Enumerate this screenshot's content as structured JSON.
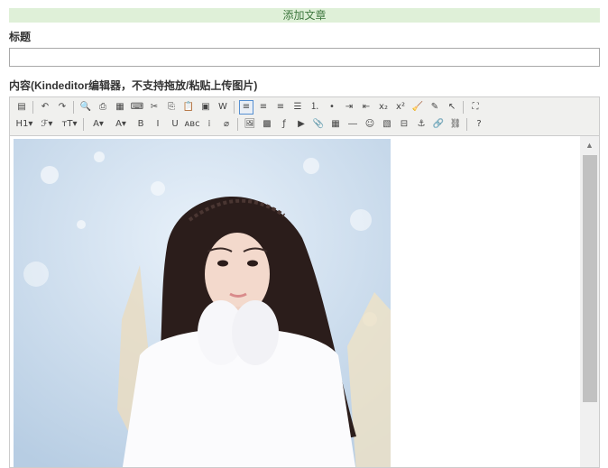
{
  "page": {
    "header": "添加文章"
  },
  "form": {
    "title_label": "标题",
    "title_value": "",
    "content_label": "内容(Kindeditor编辑器，不支持拖放/粘贴上传图片)"
  },
  "editor": {
    "toolbar_row1": [
      {
        "name": "source-icon",
        "glyph": "▤"
      },
      {
        "sep": true
      },
      {
        "name": "undo-icon",
        "glyph": "↶"
      },
      {
        "name": "redo-icon",
        "glyph": "↷"
      },
      {
        "sep": true
      },
      {
        "name": "preview-icon",
        "glyph": "🔍"
      },
      {
        "name": "print-icon",
        "glyph": "⎙"
      },
      {
        "name": "template-icon",
        "glyph": "▦"
      },
      {
        "name": "code-icon",
        "glyph": "⌨"
      },
      {
        "name": "cut-icon",
        "glyph": "✂"
      },
      {
        "name": "copy-icon",
        "glyph": "⎘"
      },
      {
        "name": "paste-icon",
        "glyph": "📋"
      },
      {
        "name": "paste-plain-icon",
        "glyph": "▣"
      },
      {
        "name": "paste-word-icon",
        "glyph": "W"
      },
      {
        "sep": true
      },
      {
        "name": "align-left-icon",
        "glyph": "≡",
        "active": true
      },
      {
        "name": "align-center-icon",
        "glyph": "≡"
      },
      {
        "name": "align-right-icon",
        "glyph": "≡"
      },
      {
        "name": "align-justify-icon",
        "glyph": "☰"
      },
      {
        "name": "ordered-list-icon",
        "glyph": "⒈"
      },
      {
        "name": "unordered-list-icon",
        "glyph": "•"
      },
      {
        "name": "indent-icon",
        "glyph": "⇥"
      },
      {
        "name": "outdent-icon",
        "glyph": "⇤"
      },
      {
        "name": "subscript-icon",
        "glyph": "x₂"
      },
      {
        "name": "superscript-icon",
        "glyph": "x²"
      },
      {
        "name": "clear-format-icon",
        "glyph": "🧹"
      },
      {
        "name": "quick-format-icon",
        "glyph": "✎"
      },
      {
        "name": "select-all-icon",
        "glyph": "↖"
      },
      {
        "sep": true
      },
      {
        "name": "fullscreen-icon",
        "glyph": "⛶"
      }
    ],
    "toolbar_row2": [
      {
        "name": "heading-icon",
        "glyph": "H1▾",
        "wide": true
      },
      {
        "name": "font-family-icon",
        "glyph": "ℱ▾",
        "wide": true
      },
      {
        "name": "font-size-icon",
        "glyph": "ᴛT▾",
        "wide": true
      },
      {
        "sep": true
      },
      {
        "name": "font-color-icon",
        "glyph": "A▾",
        "wide": true
      },
      {
        "name": "highlight-color-icon",
        "glyph": "A▾",
        "wide": true
      },
      {
        "name": "bold-icon",
        "glyph": "B"
      },
      {
        "name": "italic-icon",
        "glyph": "I"
      },
      {
        "name": "underline-icon",
        "glyph": "U"
      },
      {
        "name": "strikethrough-icon",
        "glyph": "ᴀʙᴄ"
      },
      {
        "name": "line-height-icon",
        "glyph": "⁞"
      },
      {
        "name": "remove-format-icon",
        "glyph": "⌀"
      },
      {
        "sep": true
      },
      {
        "name": "image-icon",
        "glyph": "🖼"
      },
      {
        "name": "multi-image-icon",
        "glyph": "▩"
      },
      {
        "name": "flash-icon",
        "glyph": "ƒ"
      },
      {
        "name": "media-icon",
        "glyph": "▶"
      },
      {
        "name": "insert-file-icon",
        "glyph": "📎"
      },
      {
        "name": "table-icon",
        "glyph": "▦"
      },
      {
        "name": "horizontal-rule-icon",
        "glyph": "―"
      },
      {
        "name": "emoticons-icon",
        "glyph": "☺"
      },
      {
        "name": "baidu-map-icon",
        "glyph": "▧"
      },
      {
        "name": "page-break-icon",
        "glyph": "⊟"
      },
      {
        "name": "anchor-icon",
        "glyph": "⚓"
      },
      {
        "name": "link-icon",
        "glyph": "🔗"
      },
      {
        "name": "unlink-icon",
        "glyph": "⛓"
      },
      {
        "sep": true
      },
      {
        "name": "about-icon",
        "glyph": "?"
      }
    ]
  }
}
